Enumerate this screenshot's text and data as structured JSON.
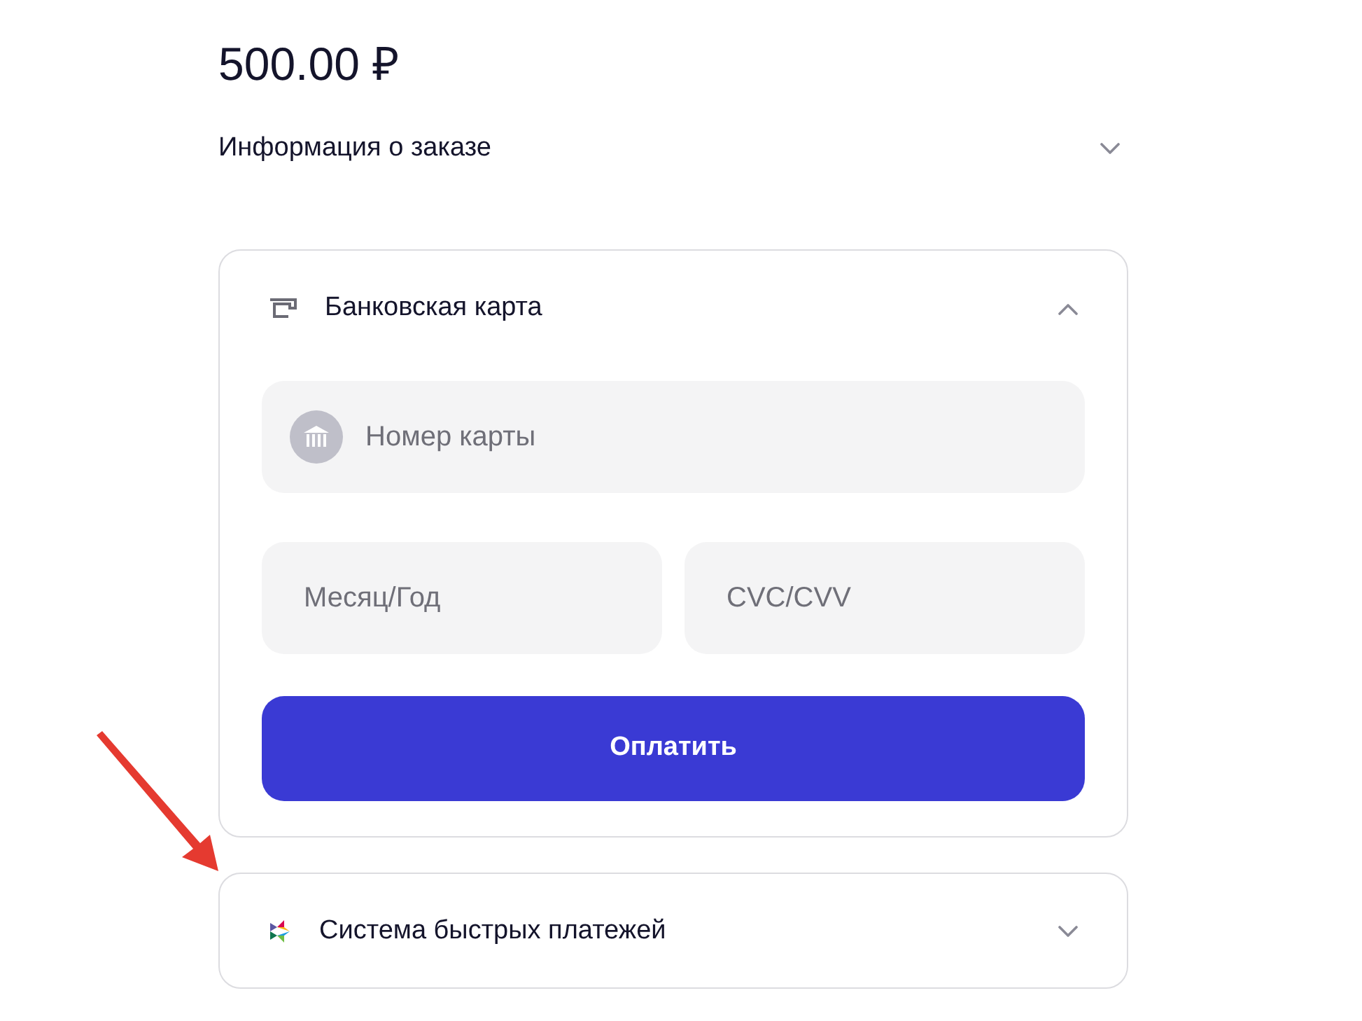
{
  "amount": "500.00 ₽",
  "order_info": {
    "label": "Информация о заказе",
    "expanded": false
  },
  "methods": [
    {
      "kind": "card",
      "title": "Банковская карта",
      "expanded": true,
      "card_number": {
        "placeholder": "Номер карты"
      },
      "expiry": {
        "placeholder": "Месяц/Год"
      },
      "cvc": {
        "placeholder": "CVC/CVV"
      },
      "pay_button": "Оплатить"
    },
    {
      "kind": "sbp",
      "title": "Система быстрых платежей",
      "expanded": false
    }
  ]
}
